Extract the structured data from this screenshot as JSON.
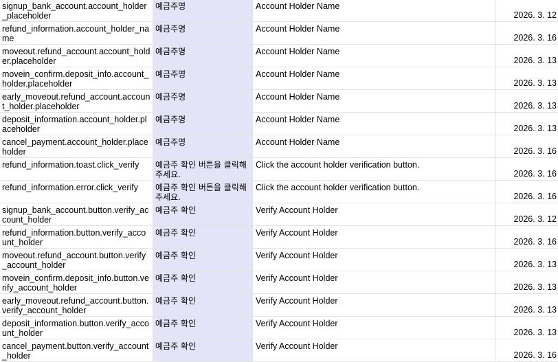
{
  "rows": [
    {
      "key": "signup_bank_account.account_holder_placeholder",
      "ko": "예금주명",
      "en": "Account Holder Name",
      "date": "2026. 3. 12"
    },
    {
      "key": "refund_information.account_holder_name",
      "ko": "예금주명",
      "en": "Account Holder Name",
      "date": "2026. 3. 16"
    },
    {
      "key": "moveout.refund_account.account_holder.placeholder",
      "ko": "예금주명",
      "en": "Account Holder Name",
      "date": "2026. 3. 13"
    },
    {
      "key": "movein_confirm.deposit_info.account_holder.placeholder",
      "ko": "예금주명",
      "en": "Account Holder Name",
      "date": "2026. 3. 13"
    },
    {
      "key": "early_moveout.refund_account.account_holder.placeholder",
      "ko": "예금주명",
      "en": "Account Holder Name",
      "date": "2026. 3. 13"
    },
    {
      "key": "deposit_information.account_holder.placeholder",
      "ko": "예금주명",
      "en": "Account Holder Name",
      "date": "2026. 3. 13"
    },
    {
      "key": "cancel_payment.account_holder.placeholder",
      "ko": "예금주명",
      "en": "Account Holder Name",
      "date": "2026. 3. 16"
    },
    {
      "key": "refund_information.toast.click_verify",
      "ko": "예금주 확인 버튼을 클릭해주세요.",
      "en": "Click the account holder verification button.",
      "date": "2026. 3. 16"
    },
    {
      "key": "refund_information.error.click_verify",
      "ko": "예금주 확인 버튼을 클릭해주세요.",
      "en": "Click the account holder verification button.",
      "date": "2026. 3. 16"
    },
    {
      "key": "signup_bank_account.button.verify_account_holder",
      "ko": "예금주 확인",
      "en": "Verify Account Holder",
      "date": "2026. 3. 12"
    },
    {
      "key": "refund_information.button.verify_account_holder",
      "ko": "예금주 확인",
      "en": "Verify Account Holder",
      "date": "2026. 3. 16"
    },
    {
      "key": "moveout.refund_account.button.verify_account_holder",
      "ko": "예금주 확인",
      "en": "Verify Account Holder",
      "date": "2026. 3. 13"
    },
    {
      "key": "movein_confirm.deposit_info.button.verify_account_holder",
      "ko": "예금주 확인",
      "en": "Verify Account Holder",
      "date": "2026. 3. 13"
    },
    {
      "key": "early_moveout.refund_account.button.verify_account_holder",
      "ko": "예금주 확인",
      "en": "Verify Account Holder",
      "date": "2026. 3. 13"
    },
    {
      "key": "deposit_information.button.verify_account_holder",
      "ko": "예금주 확인",
      "en": "Verify Account Holder",
      "date": "2026. 3. 13"
    },
    {
      "key": "cancel_payment.button.verify_account_holder",
      "ko": "예금주 확인",
      "en": "Verify Account Holder",
      "date": "2026. 3. 16"
    }
  ]
}
